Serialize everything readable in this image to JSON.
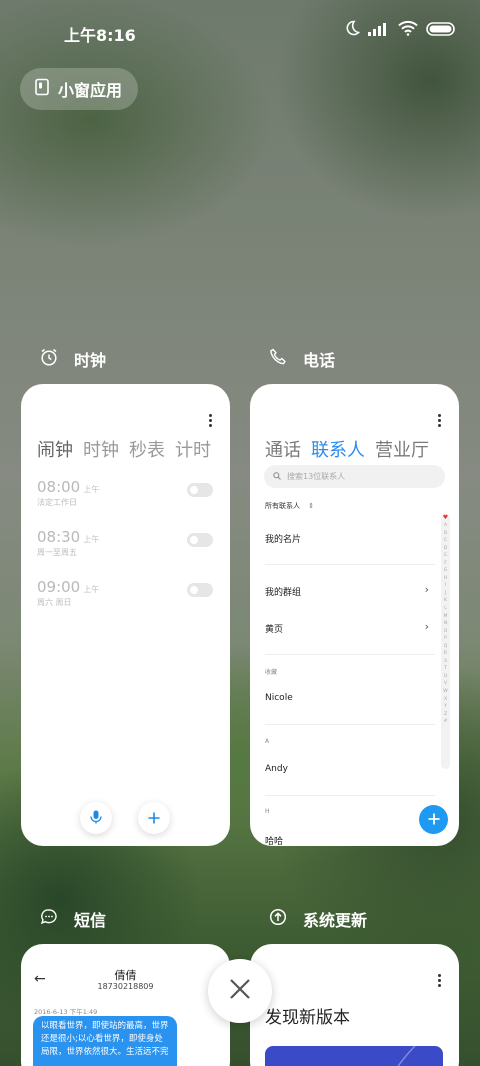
{
  "status_bar": {
    "time": "上午8:16"
  },
  "floating_window": {
    "label": "小窗应用"
  },
  "cards": {
    "clock": {
      "app_name": "时钟",
      "tabs": [
        "闹钟",
        "时钟",
        "秒表",
        "计时"
      ],
      "alarms": [
        {
          "time": "08:00",
          "ampm": "上午",
          "repeat": "法定工作日"
        },
        {
          "time": "08:30",
          "ampm": "上午",
          "repeat": "周一至周五"
        },
        {
          "time": "09:00",
          "ampm": "上午",
          "repeat": "周六 周日"
        }
      ]
    },
    "phone": {
      "app_name": "电话",
      "tabs": [
        "通话",
        "联系人",
        "营业厅"
      ],
      "search_placeholder": "搜索13位联系人",
      "all_contacts": "所有联系人",
      "my_card": "我的名片",
      "my_groups": "我的群组",
      "yellow_pages": "黄页",
      "favorites_label": "收藏",
      "favorite_contact": "Nicole",
      "section_a": "A",
      "contact_a": "Andy",
      "section_h": "H",
      "contact_h": "哈哈",
      "index_letters": [
        "A",
        "B",
        "C",
        "D",
        "E",
        "F",
        "G",
        "H",
        "I",
        "J",
        "K",
        "L",
        "M",
        "N",
        "O",
        "P",
        "Q",
        "R",
        "S",
        "T",
        "U",
        "V",
        "W",
        "X",
        "Y",
        "Z",
        "#"
      ]
    },
    "sms": {
      "app_name": "短信",
      "contact_name": "倩倩",
      "contact_number": "18730218809",
      "timestamp": "2016-6-13 下午1:49",
      "message": "以眼看世界，即使站的最高，世界还是很小;以心看世界，即使身处局限，世界依然很大。生活远不完"
    },
    "update": {
      "app_name": "系统更新",
      "headline": "发现新版本"
    }
  },
  "colors": {
    "accent": "#2a8cf0",
    "fab": "#1e9af3",
    "card_bg": "#ffffff"
  }
}
